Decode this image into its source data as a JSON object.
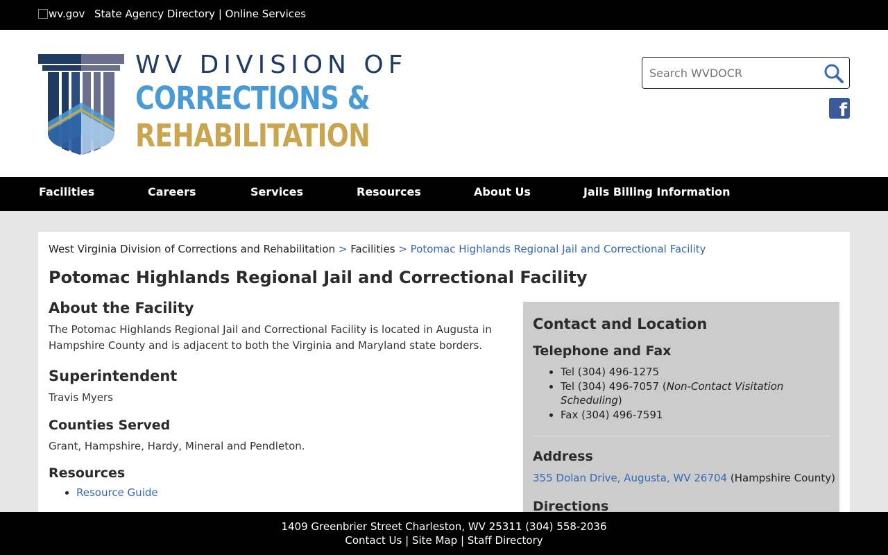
{
  "topbar": {
    "logo_alt": "wv.gov",
    "agency_directory": "State Agency Directory",
    "separator": "|",
    "online_services": "Online Services"
  },
  "logo": {
    "line1": "WV DIVISION OF",
    "line2": "CORRECTIONS &",
    "line3": "REHABILITATION",
    "colors": {
      "navy": "#1f3b64",
      "blue": "#4a9bd4",
      "gold": "#c9a54f"
    }
  },
  "search": {
    "placeholder": "Search WVDOCR",
    "icon": "search-icon"
  },
  "social": {
    "icon": "facebook-icon"
  },
  "nav": {
    "items": [
      "Facilities",
      "Careers",
      "Services",
      "Resources",
      "About Us",
      "Jails Billing Information"
    ]
  },
  "breadcrumb": {
    "home": "West Virginia Division of Corrections and Rehabilitation",
    "sep": ">",
    "parent": "Facilities",
    "current": "Potomac Highlands Regional Jail and Correctional Facility"
  },
  "page": {
    "title": "Potomac Highlands Regional Jail and Correctional Facility",
    "about_heading": "About the Facility",
    "about_text": "The Potomac Highlands Regional Jail and Correctional Facility is located in Augusta in Hampshire County and is adjacent to both the Virginia and Maryland state borders.",
    "superintendent_heading": "Superintendent",
    "superintendent_name": "Travis Myers",
    "counties_heading": "Counties Served",
    "counties_text": "Grant, Hampshire, Hardy, Mineral and Pendleton.",
    "resources_heading": "Resources",
    "resources": [
      "Resource Guide"
    ]
  },
  "contact": {
    "heading": "Contact and Location",
    "tel_heading": "Telephone and Fax",
    "tel1": "Tel (304) 496-1275",
    "tel2_prefix": "Tel (304) 496-7057 (",
    "tel2_note": "Non-Contact Visitation Scheduling",
    "tel2_suffix": ")",
    "fax": "Fax (304) 496-7591",
    "address_heading": "Address",
    "address_link": "355 Dolan Drive, Augusta, WV 26704",
    "address_county": "(Hampshire County)",
    "directions_heading": "Directions"
  },
  "footer": {
    "address": "1409 Greenbrier Street Charleston, WV 25311 (304) 558-2036",
    "contact": "Contact Us",
    "site_map": "Site Map",
    "staff_directory": "Staff Directory",
    "sep": "|"
  }
}
